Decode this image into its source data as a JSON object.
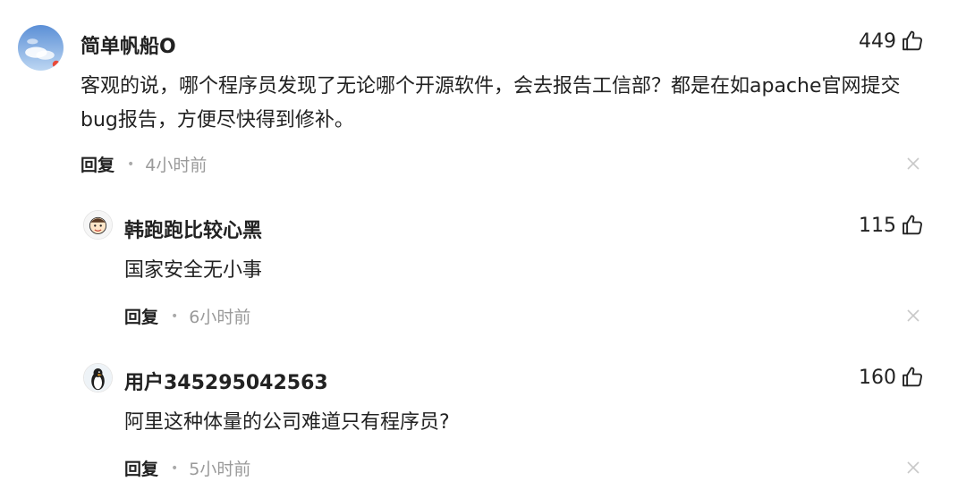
{
  "comments": [
    {
      "username": "简单帆船O",
      "likes": "449",
      "text": "客观的说，哪个程序员发现了无论哪个开源软件，会去报告工信部？都是在如apache官网提交bug报告，方便尽快得到修补。",
      "reply_label": "回复",
      "time": "4小时前",
      "avatar": "sky-clouds-avatar"
    },
    {
      "username": "韩跑跑比较心黑",
      "likes": "115",
      "text": "国家安全无小事",
      "reply_label": "回复",
      "time": "6小时前",
      "avatar": "cartoon-face-avatar"
    },
    {
      "username": "用户345295042563",
      "likes": "160",
      "text": "阿里这种体量的公司难道只有程序员?",
      "reply_label": "回复",
      "time": "5小时前",
      "avatar": "penguin-avatar"
    }
  ],
  "icons": {
    "like": "thumbs-up-icon",
    "dismiss": "close-icon"
  },
  "colors": {
    "primary_text": "#222222",
    "secondary_text": "#9a9a9a",
    "close_icon": "#c8c8c8"
  }
}
